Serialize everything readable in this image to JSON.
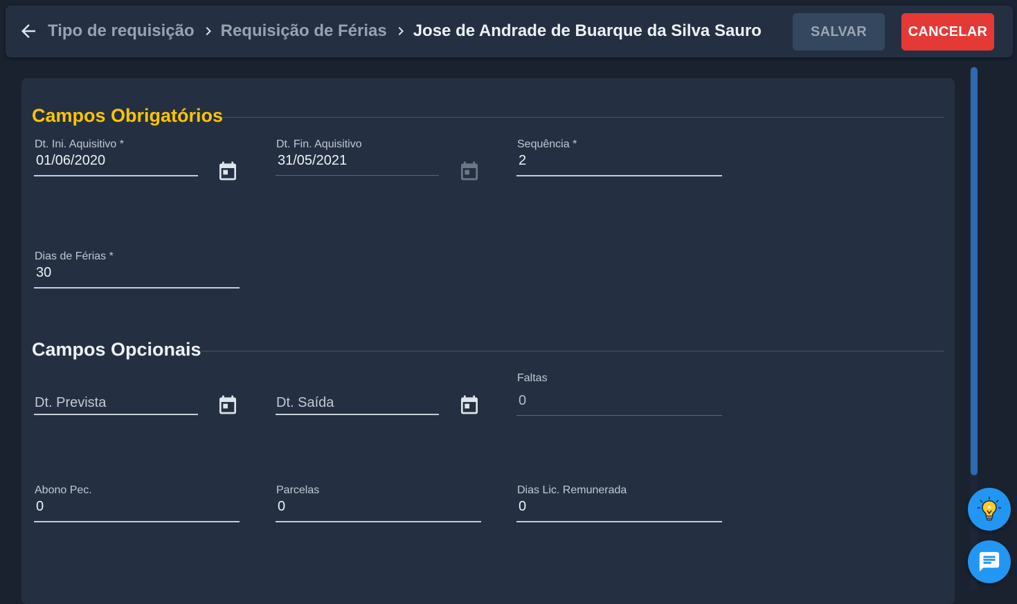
{
  "header": {
    "breadcrumbs": [
      {
        "label": "Tipo de requisição"
      },
      {
        "label": "Requisição de Férias"
      },
      {
        "label": "Jose de Andrade de Buarque da Silva Sauro"
      }
    ],
    "save_label": "SALVAR",
    "cancel_label": "CANCELAR"
  },
  "colors": {
    "accent_required": "#ffc400",
    "cancel": "#e53935",
    "fab": "#2196f3",
    "background": "#1a2230",
    "surface": "#243042"
  },
  "required": {
    "title": "Campos Obrigatórios",
    "dt_ini": {
      "label": "Dt. Ini. Aquisitivo *",
      "value": "01/06/2020"
    },
    "dt_fin": {
      "label": "Dt. Fin. Aquisitivo",
      "value": "31/05/2021"
    },
    "sequencia": {
      "label": "Sequência *",
      "value": "2"
    },
    "dias_ferias": {
      "label": "Dias de Férias *",
      "value": "30"
    }
  },
  "optional": {
    "title": "Campos Opcionais",
    "dt_prevista": {
      "placeholder": "Dt. Prevista"
    },
    "dt_saida": {
      "placeholder": "Dt. Saída"
    },
    "faltas": {
      "label": "Faltas",
      "value": "0"
    },
    "abono_pec": {
      "label": "Abono Pec.",
      "value": "0"
    },
    "parcelas": {
      "label": "Parcelas",
      "value": "0"
    },
    "dias_lic_remunerada": {
      "label": "Dias Lic. Remunerada",
      "value": "0"
    }
  },
  "icons": {
    "back": "arrow-left-icon",
    "separator": "chevron-right-icon",
    "calendar": "calendar-icon",
    "tips": "lightbulb-icon",
    "chat": "chat-icon"
  }
}
